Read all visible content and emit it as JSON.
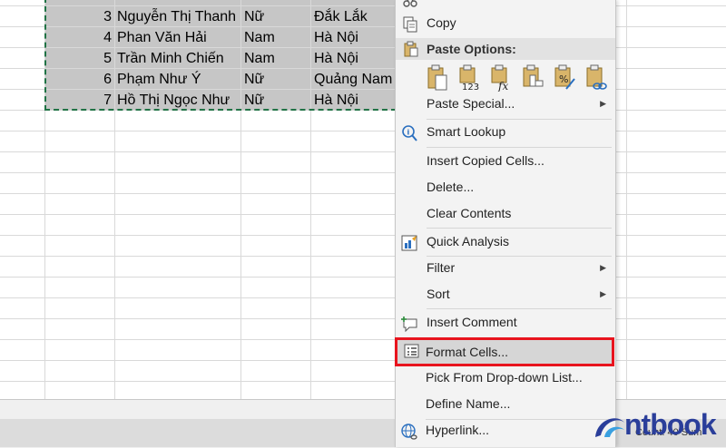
{
  "sheet": {
    "rows": [
      {
        "no": "3",
        "name": "Nguyễn Thị Thanh",
        "gender": "Nữ",
        "province": "Đắk Lắk"
      },
      {
        "no": "4",
        "name": "Phan Văn Hải",
        "gender": "Nam",
        "province": "Hà Nội"
      },
      {
        "no": "5",
        "name": "Trần Minh Chiến",
        "gender": "Nam",
        "province": "Hà Nội"
      },
      {
        "no": "6",
        "name": "Phạm Như Ý",
        "gender": "Nữ",
        "province": "Quảng Nam"
      },
      {
        "no": "7",
        "name": "Hồ Thị Ngọc Như",
        "gender": "Nữ",
        "province": "Hà Nội"
      }
    ]
  },
  "status": {
    "count": "Count: 40   Sum"
  },
  "context_menu": {
    "copy": "Copy",
    "paste_options": "Paste Options:",
    "paste_special": "Paste Special...",
    "smart_lookup": "Smart Lookup",
    "insert_copied_cells": "Insert Copied Cells...",
    "delete": "Delete...",
    "clear_contents": "Clear Contents",
    "quick_analysis": "Quick Analysis",
    "filter": "Filter",
    "sort": "Sort",
    "insert_comment": "Insert Comment",
    "format_cells": "Format Cells...",
    "pick_from_list": "Pick From Drop-down List...",
    "define_name": "Define Name...",
    "hyperlink": "Hyperlink..."
  },
  "logo": {
    "text": "ntbook",
    "color": "#2a3e9a"
  },
  "colors": {
    "selection": "#c6c6c6",
    "highlight_border": "#e8141e",
    "menu_bg": "#f3f3f3"
  }
}
